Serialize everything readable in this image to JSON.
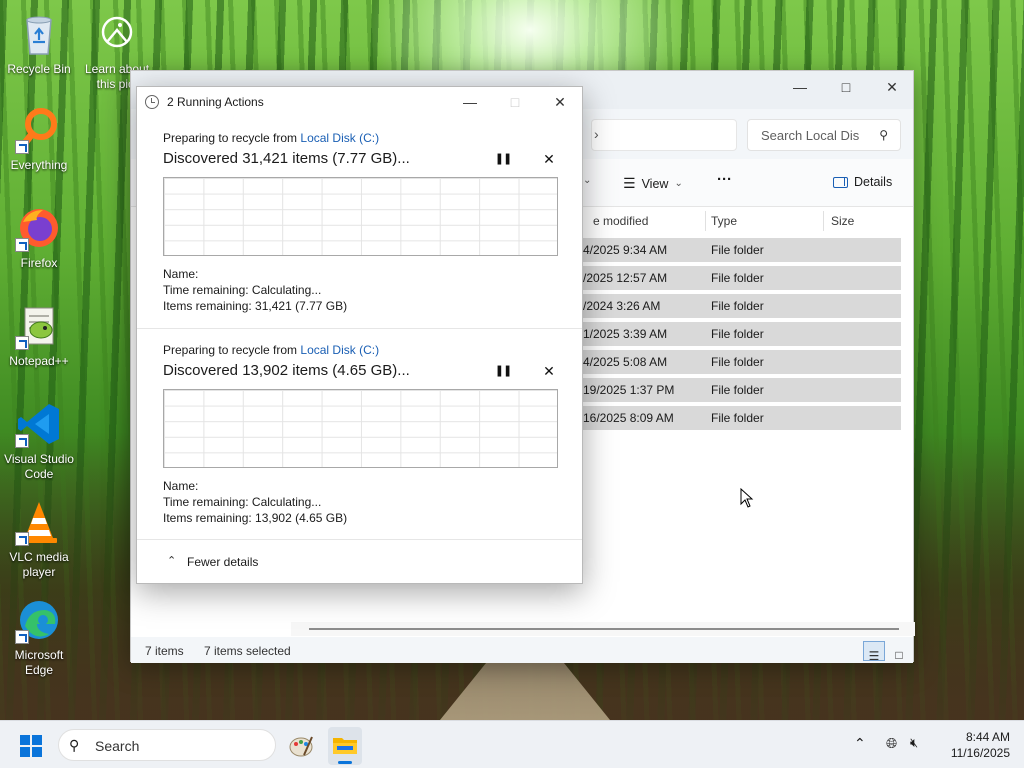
{
  "desktop": {
    "icons": [
      {
        "label": "Recycle Bin",
        "icon": "recycle-bin-icon"
      },
      {
        "label": "Learn about this pict",
        "icon": "learn-about-picture-icon"
      },
      {
        "label": "Everything",
        "icon": "everything-search-icon"
      },
      {
        "label": "Firefox",
        "icon": "firefox-icon"
      },
      {
        "label": "Notepad++",
        "icon": "notepadpp-icon"
      },
      {
        "label": "Visual Studio Code",
        "icon": "vscode-icon"
      },
      {
        "label": "VLC media player",
        "icon": "vlc-icon"
      },
      {
        "label": "Microsoft Edge",
        "icon": "edge-icon"
      }
    ]
  },
  "explorer": {
    "search_placeholder": "Search Local Dis",
    "toolbar": {
      "view_label": "View",
      "details_label": "Details",
      "more": "···"
    },
    "columns": {
      "modified": "e modified",
      "type": "Type",
      "size": "Size"
    },
    "rows": [
      {
        "modified": "4/2025 9:34 AM",
        "type": "File folder"
      },
      {
        "modified": "/2025 12:57 AM",
        "type": "File folder"
      },
      {
        "modified": "/2024 3:26 AM",
        "type": "File folder"
      },
      {
        "modified": "1/2025 3:39 AM",
        "type": "File folder"
      },
      {
        "modified": "4/2025 5:08 AM",
        "type": "File folder"
      },
      {
        "modified": "19/2025 1:37 PM",
        "type": "File folder"
      },
      {
        "modified": "16/2025 8:09 AM",
        "type": "File folder"
      }
    ],
    "status": {
      "items": "7 items",
      "selected": "7 items selected"
    }
  },
  "dialog": {
    "title": "2 Running Actions",
    "operations": [
      {
        "prep_prefix": "Preparing to recycle from ",
        "location": "Local Disk (C:)",
        "discovered": "Discovered 31,421 items (7.77 GB)...",
        "name_label": "Name:",
        "time_remaining": "Time remaining:  Calculating...",
        "items_remaining": "Items remaining:  31,421 (7.77 GB)"
      },
      {
        "prep_prefix": "Preparing to recycle from ",
        "location": "Local Disk (C:)",
        "discovered": "Discovered 13,902 items (4.65 GB)...",
        "name_label": "Name:",
        "time_remaining": "Time remaining:  Calculating...",
        "items_remaining": "Items remaining:  13,902 (4.65 GB)"
      }
    ],
    "pause_glyph": "❚❚",
    "cancel_glyph": "✕",
    "fewer_details": "Fewer details"
  },
  "taskbar": {
    "search_placeholder": "Search",
    "time": "8:44 AM",
    "date": "11/16/2025"
  }
}
